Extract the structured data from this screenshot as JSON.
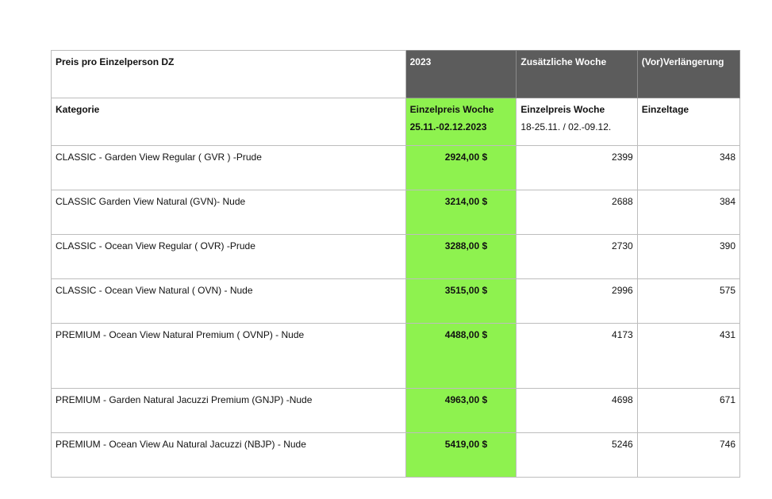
{
  "header": {
    "price_label": "Preis pro Einzelperson DZ",
    "year": "2023",
    "additional_week": "Zusätzliche Woche",
    "extension": "(Vor)Verlängerung"
  },
  "subheader": {
    "category": "Kategorie",
    "week_price_line1": "Einzelpreis Woche",
    "week_price_line2": "25.11.-02.12.2023",
    "add_price_line1": "Einzelpreis Woche",
    "add_price_line2": "18-25.11. / 02.-09.12.",
    "single_days": "Einzeltage"
  },
  "rows": [
    {
      "category": "CLASSIC - Garden View Regular ( GVR ) -Prude",
      "price_2023": "2924,00 $",
      "additional_week": "2399",
      "extension": "348"
    },
    {
      "category": "CLASSIC Garden View Natural (GVN)- Nude",
      "price_2023": "3214,00 $",
      "additional_week": "2688",
      "extension": "384"
    },
    {
      "category": "CLASSIC - Ocean View Regular ( OVR) -Prude",
      "price_2023": "3288,00 $",
      "additional_week": "2730",
      "extension": "390"
    },
    {
      "category": "CLASSIC - Ocean View Natural ( OVN) - Nude",
      "price_2023": "3515,00 $",
      "additional_week": "2996",
      "extension": "575"
    },
    {
      "category": "PREMIUM - Ocean View Natural Premium ( OVNP) - Nude",
      "price_2023": "4488,00 $",
      "additional_week": "4173",
      "extension": "431"
    },
    {
      "category": "PREMIUM - Garden Natural Jacuzzi Premium (GNJP) -Nude",
      "price_2023": "4963,00 $",
      "additional_week": "4698",
      "extension": "671"
    },
    {
      "category": "PREMIUM - Ocean View Au Natural Jacuzzi (NBJP) - Nude",
      "price_2023": "5419,00 $",
      "additional_week": "5246",
      "extension": "746"
    }
  ],
  "colors": {
    "header_dark": "#5c5c5c",
    "highlight_green": "#8ef24f",
    "border": "#bdbdbd"
  }
}
